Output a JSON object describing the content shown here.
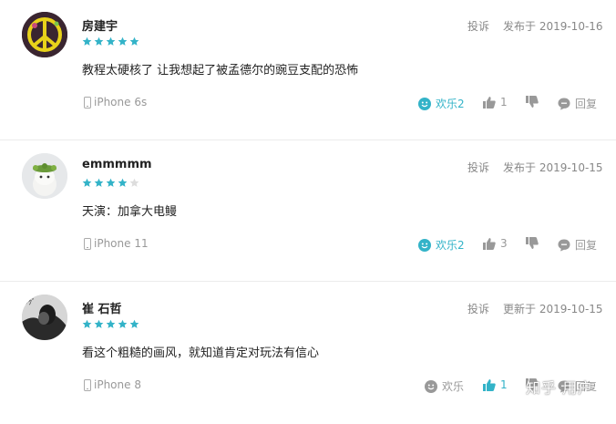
{
  "colors": {
    "accent": "#33b3c8",
    "star_filled": "#33b3c8",
    "star_empty": "#dddddd",
    "muted": "#999999"
  },
  "reviews": [
    {
      "username": "房建宇",
      "rating": 5,
      "report_label": "投诉",
      "date_text": "发布于 2019-10-16",
      "content": "教程太硬核了 让我想起了被孟德尔的豌豆支配的恐怖",
      "device": "iPhone 6s",
      "fun_label": "欢乐2",
      "likes": "1",
      "reply_label": "回复",
      "fun_active": true,
      "like_active": false,
      "avatar_icon": "peace-sign-icon"
    },
    {
      "username": "emmmmm",
      "rating": 4,
      "report_label": "投诉",
      "date_text": "发布于 2019-10-15",
      "content": "天演：加拿大电鳗",
      "device": "iPhone 11",
      "fun_label": "欢乐2",
      "likes": "3",
      "reply_label": "回复",
      "fun_active": true,
      "like_active": false,
      "avatar_icon": "cat-photo-avatar"
    },
    {
      "username": "崔 石哲",
      "rating": 5,
      "report_label": "投诉",
      "date_text": "更新于 2019-10-15",
      "content": "看这个粗糙的画风，就知道肯定对玩法有信心",
      "device": "iPhone 8",
      "fun_label": "欢乐",
      "likes": "1",
      "reply_label": "回复",
      "fun_active": false,
      "like_active": true,
      "avatar_icon": "person-photo-avatar"
    }
  ],
  "watermark": "知乎 用户"
}
